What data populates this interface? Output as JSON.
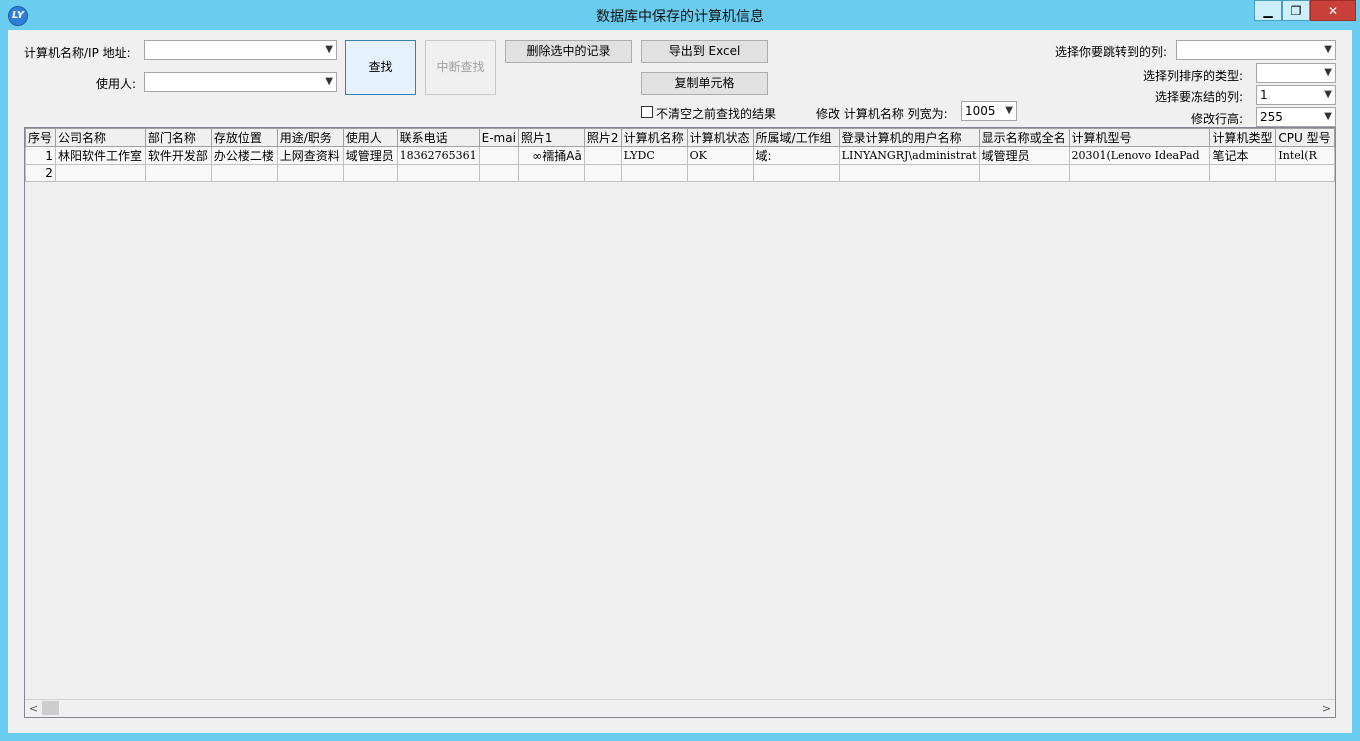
{
  "window": {
    "title": "数据库中保存的计算机信息",
    "icon_text": "LY",
    "min_glyph": "▁",
    "max_glyph": "❐",
    "close_glyph": "✕"
  },
  "search": {
    "name_ip_label": "计算机名称/IP 地址:",
    "name_ip_value": "",
    "user_label": "使用人:",
    "user_value": "",
    "find_button": "查找",
    "stop_button": "中断查找"
  },
  "toolbar": {
    "delete_button": "删除选中的记录",
    "export_button": "导出到 Excel",
    "copy_button": "复制单元格",
    "keep_results_label": "不清空之前查找的结果",
    "column_width_label": "修改 计算机名称 列宽为:",
    "column_width_value": "1005"
  },
  "right_panel": {
    "jump_column_label": "选择你要跳转到的列:",
    "jump_column_value": "",
    "sort_type_label": "选择列排序的类型:",
    "sort_type_value": "",
    "freeze_label": "选择要冻结的列:",
    "freeze_value": "1",
    "row_height_label": "修改行高:",
    "row_height_value": "255"
  },
  "grid": {
    "columns": [
      "序号",
      "公司名称",
      "部门名称",
      "存放位置",
      "用途/职务",
      "使用人",
      "联系电话",
      "E-mai",
      "照片1",
      "照片2",
      "计算机名称",
      "计算机状态",
      "所属域/工作组",
      "登录计算机的用户名称",
      "显示名称或全名",
      "计算机型号",
      "计算机类型",
      "CPU 型号"
    ],
    "rows": [
      [
        "1",
        "林阳软件工作室",
        "软件开发部",
        "办公楼二楼",
        "上网查资料",
        "域管理员",
        "18362765361",
        "",
        "∞襦捅Aā",
        "",
        "LYDC",
        "OK",
        "域:",
        "LINYANGRJ\\administrat",
        "域管理员",
        "20301(Lenovo IdeaPad",
        "笔记本",
        "Intel(R"
      ],
      [
        "2",
        "",
        "",
        "",
        "",
        "",
        "",
        "",
        "",
        "",
        "",
        "",
        "",
        "",
        "",
        "",
        "",
        ""
      ]
    ]
  },
  "scrollbar": {
    "left_arrow": "<",
    "right_arrow": ">"
  }
}
